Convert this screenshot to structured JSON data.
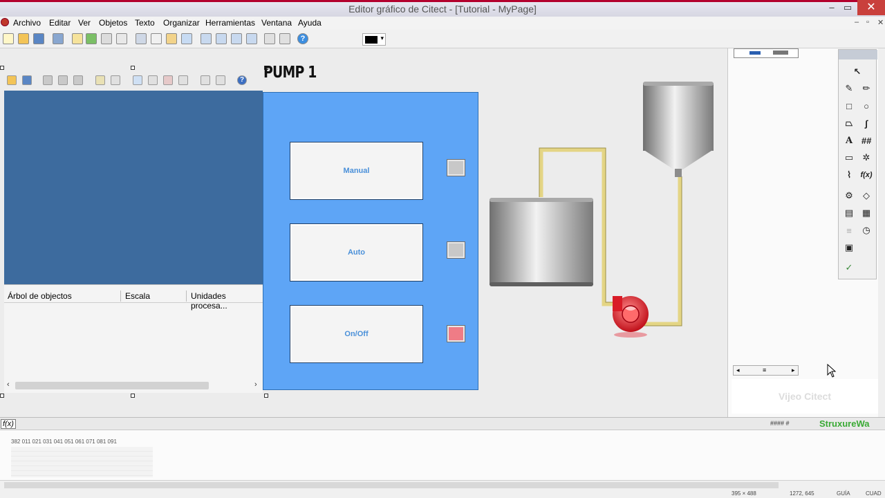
{
  "window": {
    "title": "Editor gráfico de Citect - [Tutorial - MyPage]"
  },
  "menu": {
    "items": [
      {
        "label": "Archivo"
      },
      {
        "label": "Editar"
      },
      {
        "label": "Ver"
      },
      {
        "label": "Objetos"
      },
      {
        "label": "Texto"
      },
      {
        "label": "Organizar"
      },
      {
        "label": "Herramientas"
      },
      {
        "label": "Ventana"
      },
      {
        "label": "Ayuda"
      }
    ]
  },
  "toolbar": {
    "current_color": "#000000"
  },
  "page": {
    "title": "PUMP 1",
    "buttons": [
      {
        "label": "Manual",
        "indicator_color": "#c8c8c8"
      },
      {
        "label": "Auto",
        "indicator_color": "#c8c8c8"
      },
      {
        "label": "On/Off",
        "indicator_color": "#ef7c86"
      }
    ]
  },
  "tree": {
    "columns": [
      {
        "label": "Árbol de objectos"
      },
      {
        "label": "Escala"
      },
      {
        "label": "Unidades procesa..."
      }
    ]
  },
  "right_panel": {
    "vijeo_label": "Vijeo Citect"
  },
  "bottom": {
    "formula_label": "f(x)",
    "hashes": "#### #",
    "brand": "StruxureWa",
    "row_labels": "382 011 021 031 041 051 061 071 081 091",
    "status": {
      "size": "395 × 488",
      "position": "1272, 645",
      "guia": "GUÍA",
      "cuad": "CUAD"
    }
  },
  "colors": {
    "panel_blue": "#5ea5f6",
    "pipe_yellow": "#e4d585",
    "pump_red": "#e5212c"
  }
}
